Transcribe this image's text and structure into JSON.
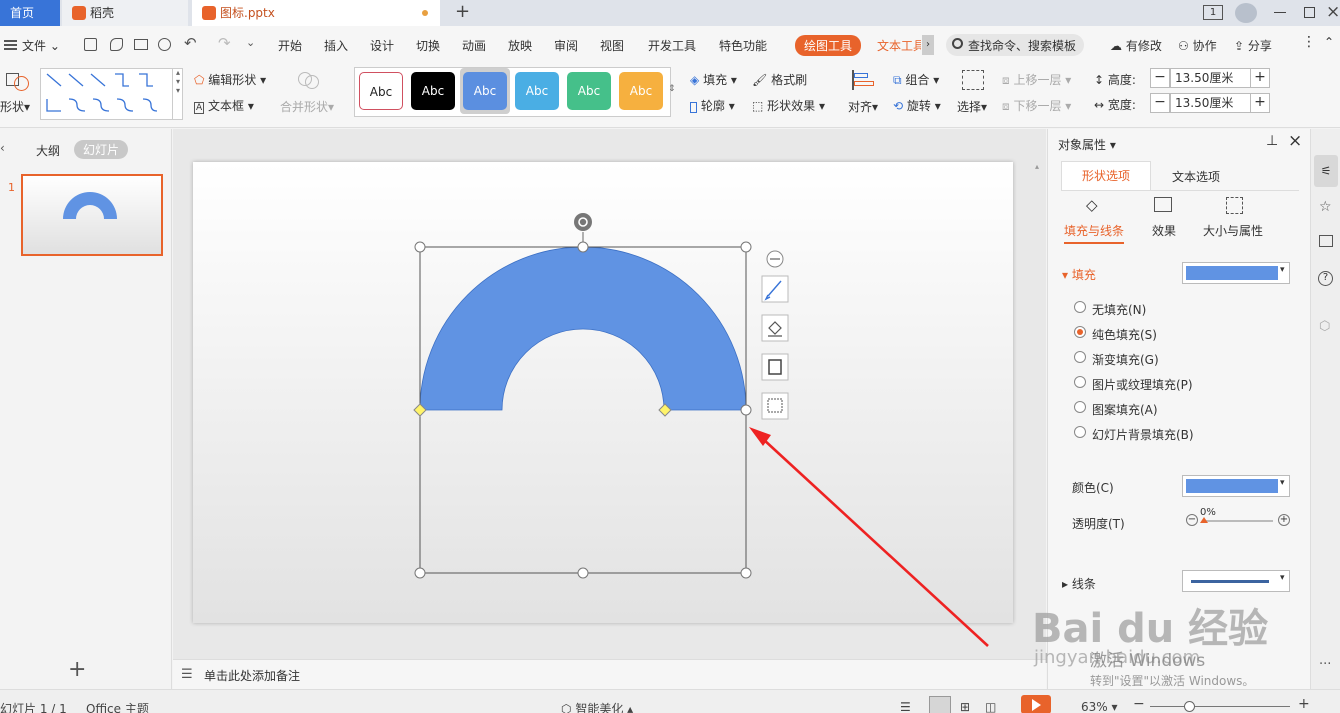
{
  "tabs": {
    "home": "首页",
    "daoke": "稻壳",
    "file": "图标.pptx",
    "add": "+"
  },
  "window": {
    "page_indicator": "1"
  },
  "menu": {
    "file": "文件",
    "items": [
      "开始",
      "插入",
      "设计",
      "切换",
      "动画",
      "放映",
      "审阅",
      "视图",
      "开发工具",
      "特色功能"
    ],
    "drawing_tools": "绘图工具",
    "text_tools": "文本工具",
    "search": "查找命令、搜索模板",
    "changes": "有修改",
    "collab": "协作",
    "share": "分享"
  },
  "ribbon": {
    "shape": "形状",
    "edit_shape": "编辑形状",
    "text_box": "文本框",
    "merge_shapes": "合并形状",
    "style_samples": [
      "Abc",
      "Abc",
      "Abc",
      "Abc",
      "Abc",
      "Abc"
    ],
    "fill": "填充",
    "format_painter": "格式刷",
    "outline": "轮廓",
    "shape_effects": "形状效果",
    "align": "对齐",
    "group": "组合",
    "rotate": "旋转",
    "select": "选择",
    "bring_forward": "上移一层",
    "send_backward": "下移一层",
    "height_label": "高度:",
    "height_value": "13.50厘米",
    "width_label": "宽度:",
    "width_value": "13.50厘米"
  },
  "left_panel": {
    "outline_tab": "大纲",
    "slides_tab": "幻灯片",
    "slide_number": "1",
    "add": "+"
  },
  "notes": {
    "placeholder": "单击此处添加备注"
  },
  "right_panel": {
    "title": "对象属性",
    "tab_shape": "形状选项",
    "tab_text": "文本选项",
    "sub_fill_line": "填充与线条",
    "sub_effects": "效果",
    "sub_size": "大小与属性",
    "fill_section": "填充",
    "fill_options": [
      "无填充(N)",
      "纯色填充(S)",
      "渐变填充(G)",
      "图片或纹理填充(P)",
      "图案填充(A)",
      "幻灯片背景填充(B)"
    ],
    "selected_fill_index": 1,
    "color_label": "颜色(C)",
    "transparency_label": "透明度(T)",
    "transparency_value": "0%",
    "line_section": "线条"
  },
  "status": {
    "slide_count": "幻灯片 1 / 1",
    "theme": "Office 主题",
    "smart_beautify": "智能美化",
    "zoom": "63%"
  },
  "watermark": {
    "brand": "Bai du 经验",
    "url": "jingyan.baidu.com",
    "activate_line1": "激活 Windows",
    "activate_line2": "转到\"设置\"以激活 Windows。"
  },
  "colors": {
    "accent": "#e8632b",
    "shape_fill": "#6093e3",
    "home_tab": "#3874d8",
    "arrow": "#ee2222",
    "style_fills": [
      "#ffffff",
      "#000000",
      "#5b8fe0",
      "#4aaee4",
      "#45c08a",
      "#f6b03f"
    ]
  }
}
